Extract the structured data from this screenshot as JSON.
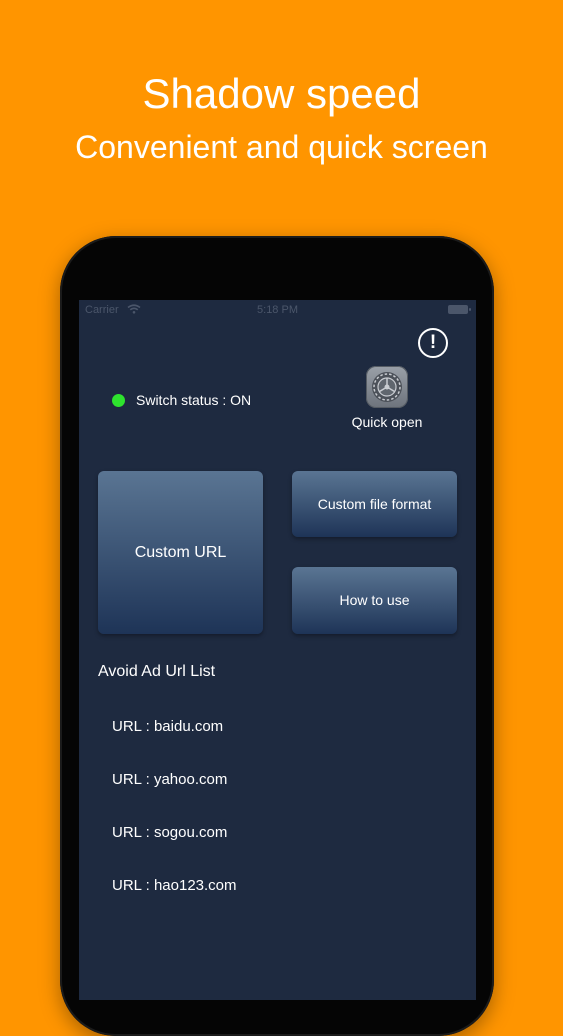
{
  "promo": {
    "title": "Shadow speed",
    "subtitle": "Convenient and quick screen"
  },
  "status_bar": {
    "carrier": "Carrier",
    "time": "5:18 PM"
  },
  "header": {
    "info_glyph": "!",
    "info_icon": "info-icon"
  },
  "switch": {
    "label": "Switch status : ON",
    "indicator_color": "#2EE32E"
  },
  "quick_open": {
    "label": "Quick open",
    "icon": "settings-gear-icon"
  },
  "tiles": {
    "custom_url": "Custom URL",
    "custom_file_format": "Custom file format",
    "how_to_use": "How to use"
  },
  "ad_list": {
    "heading": "Avoid Ad Url List",
    "items": [
      "URL : baidu.com",
      "URL : yahoo.com",
      "URL : sogou.com",
      "URL : hao123.com"
    ]
  },
  "colors": {
    "background": "#FF9500",
    "screen": "#1E2A40",
    "tile_top": "#5A7593",
    "tile_bottom": "#1E3457"
  }
}
